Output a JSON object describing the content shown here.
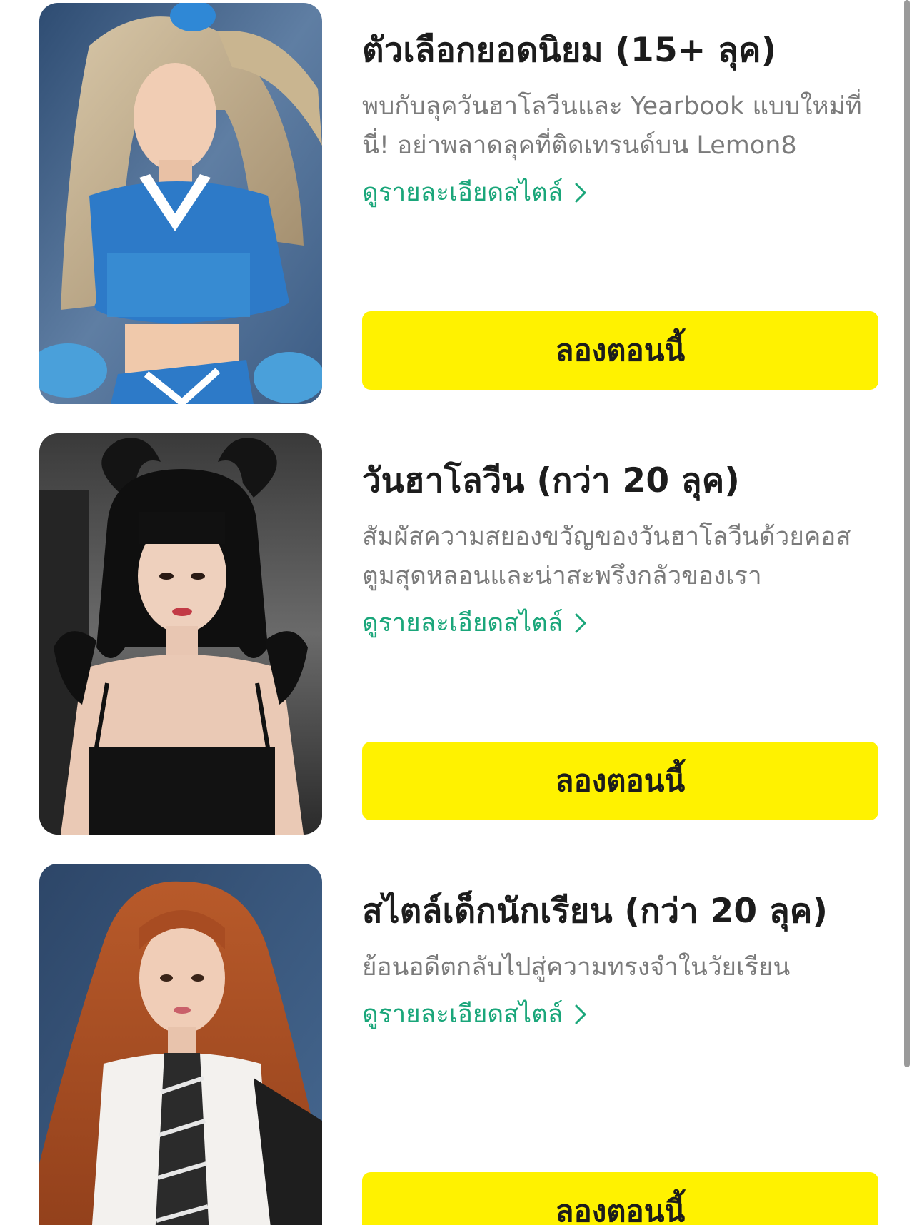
{
  "cards": [
    {
      "image": "blonde-cheerleader-portrait",
      "title": "ตัวเลือกยอดนิยม (15+ ลุค)",
      "description": "พบกับลุควันฮาโลวีนและ Yearbook แบบใหม่ที่นี่! อย่าพลาดลุคที่ติดเทรนด์บน Lemon8",
      "details_label": "ดูรายละเอียดสไตล์",
      "button_label": "ลองตอนนี้"
    },
    {
      "image": "horned-halloween-portrait",
      "title": "วันฮาโลวีน (กว่า 20 ลุค)",
      "description": "สัมผัสความสยองขวัญของวันฮาโลวีนด้วยคอสตูมสุดหลอนและน่าสะพรึงกลัวของเรา",
      "details_label": "ดูรายละเอียดสไตล์",
      "button_label": "ลองตอนนี้"
    },
    {
      "image": "redhead-student-portrait",
      "title": "สไตล์เด็กนักเรียน (กว่า 20 ลุค)",
      "description": "ย้อนอดีตกลับไปสู่ความทรงจำในวัยเรียน",
      "details_label": "ดูรายละเอียดสไตล์",
      "button_label": "ลองตอนนี้"
    }
  ],
  "icons": {
    "details": "chevron-right-icon"
  },
  "colors": {
    "button_bg": "#fff200",
    "link": "#1aa67a",
    "title": "#1c1c1c",
    "description": "#7b7b7b"
  }
}
